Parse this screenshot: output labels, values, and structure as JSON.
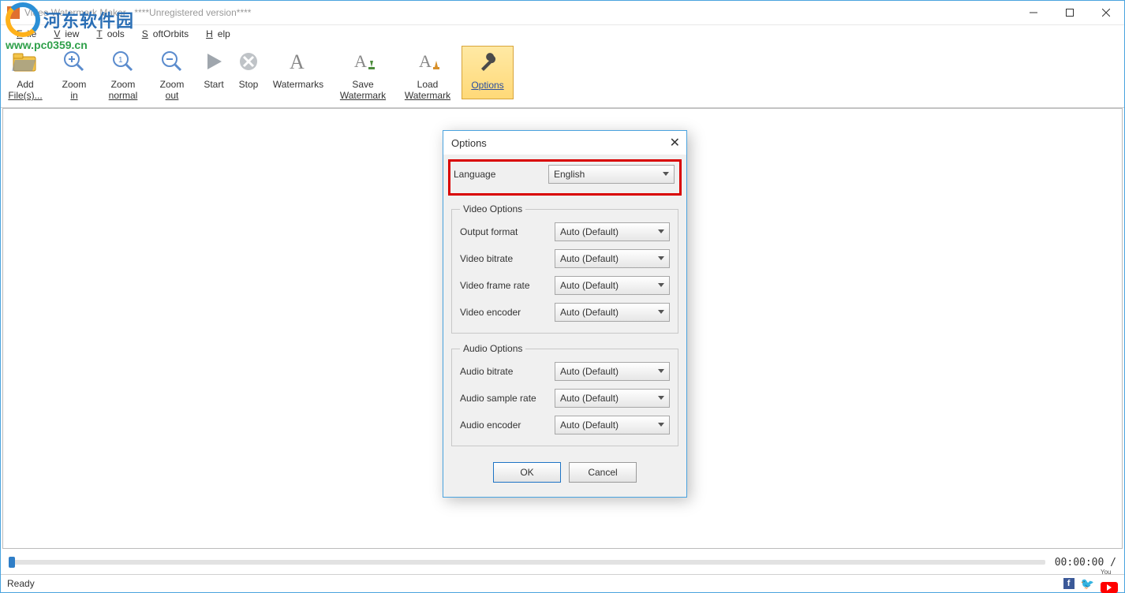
{
  "title": "Video Watermark Maker - ****Unregistered version****",
  "logo": {
    "cn": "河东软件园",
    "url": "www.pc0359.cn"
  },
  "menu": {
    "file": "File",
    "view": "View",
    "tools": "Tools",
    "softorbits": "SoftOrbits",
    "help": "Help"
  },
  "toolbar": {
    "add": {
      "l1": "Add",
      "l2": "File(s)..."
    },
    "zoom_in": {
      "l1": "Zoom",
      "l2": "in"
    },
    "zoom_normal": {
      "l1": "Zoom",
      "l2": "normal"
    },
    "zoom_out": {
      "l1": "Zoom",
      "l2": "out"
    },
    "start": "Start",
    "stop": "Stop",
    "watermarks": "Watermarks",
    "save_wm": {
      "l1": "Save",
      "l2": "Watermark"
    },
    "load_wm": {
      "l1": "Load",
      "l2": "Watermark"
    },
    "options": "Options"
  },
  "timeline": {
    "readout": "00:00:00  /"
  },
  "status": {
    "ready": "Ready"
  },
  "dialog": {
    "title": "Options",
    "language_label": "Language",
    "language_value": "English",
    "video_legend": "Video Options",
    "audio_legend": "Audio Options",
    "fields": {
      "output_format": {
        "label": "Output format",
        "value": "Auto (Default)"
      },
      "video_bitrate": {
        "label": "Video bitrate",
        "value": "Auto (Default)"
      },
      "video_framerate": {
        "label": "Video frame rate",
        "value": "Auto (Default)"
      },
      "video_encoder": {
        "label": "Video encoder",
        "value": "Auto (Default)"
      },
      "audio_bitrate": {
        "label": "Audio bitrate",
        "value": "Auto (Default)"
      },
      "audio_samplerate": {
        "label": "Audio sample rate",
        "value": "Auto (Default)"
      },
      "audio_encoder": {
        "label": "Audio encoder",
        "value": "Auto (Default)"
      }
    },
    "ok": "OK",
    "cancel": "Cancel"
  }
}
